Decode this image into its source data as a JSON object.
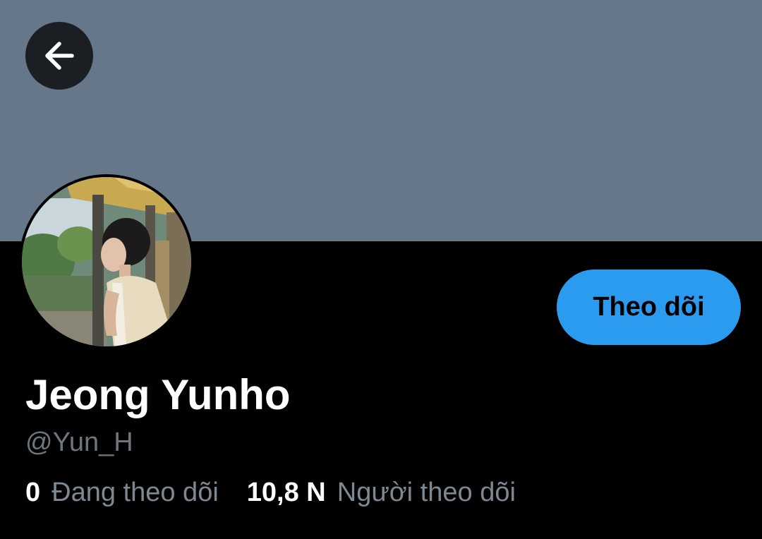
{
  "header": {
    "back_icon": "arrow-left-icon",
    "banner_color": "#66778a"
  },
  "profile": {
    "display_name": "Jeong Yunho",
    "handle": "@Yun_H",
    "follow_button_label": "Theo dõi",
    "follow_button_color": "#2b9bf0",
    "avatar": "profile-photo"
  },
  "stats": {
    "following_count": "0",
    "following_label": "Đang theo dõi",
    "followers_count": "10,8 N",
    "followers_label": "Người theo dõi"
  }
}
